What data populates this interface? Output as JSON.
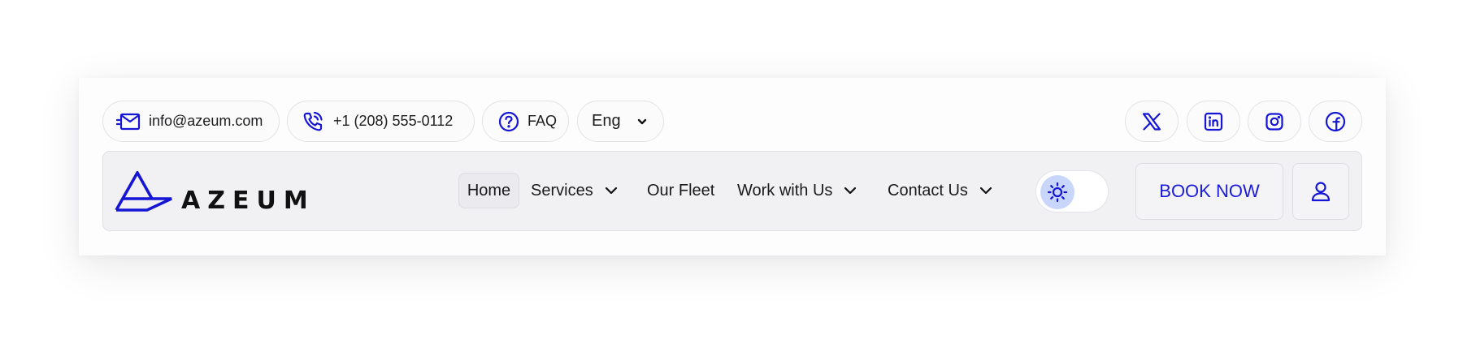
{
  "topbar": {
    "email": "info@azeum.com",
    "phone": "+1 (208) 555-0112",
    "faq": "FAQ",
    "language": "Eng"
  },
  "brand": {
    "name": "AZEUM",
    "accent_color": "#1515d6"
  },
  "nav": {
    "home": "Home",
    "services": "Services",
    "our_fleet": "Our Fleet",
    "work_with_us": "Work with Us",
    "contact_us": "Contact Us"
  },
  "theme_toggle": {
    "icon": "sun-icon",
    "state": "light"
  },
  "cta": {
    "book_now": "BOOK NOW"
  },
  "social_icons": [
    "x-icon",
    "linkedin-icon",
    "instagram-icon",
    "facebook-icon"
  ]
}
